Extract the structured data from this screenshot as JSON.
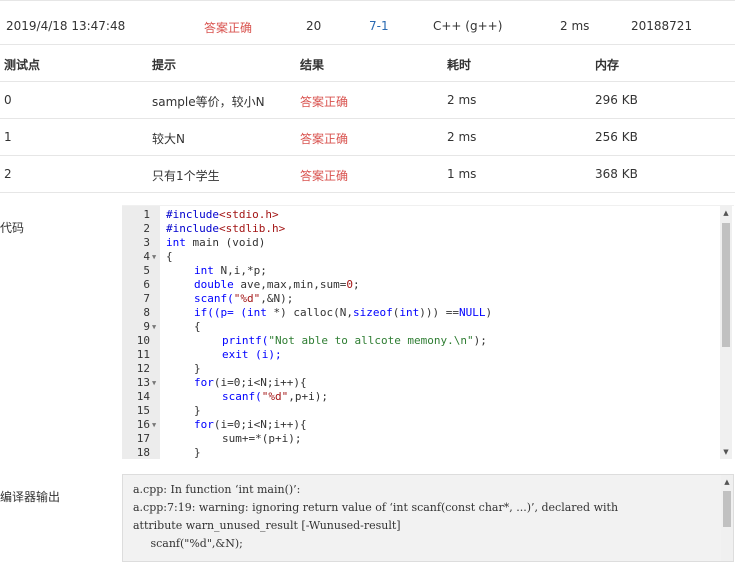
{
  "submission": {
    "time": "2019/4/18 13:47:48",
    "status": "答案正确",
    "score": "20",
    "problem": "7-1",
    "compiler": "C++ (g++)",
    "elapsed": "2 ms",
    "user": "20188721"
  },
  "results_table": {
    "headers": [
      "测试点",
      "提示",
      "结果",
      "耗时",
      "内存"
    ],
    "rows": [
      {
        "case": "0",
        "hint": "sample等价，较小N",
        "result": "答案正确",
        "time": "2 ms",
        "memory": "296 KB"
      },
      {
        "case": "1",
        "hint": "较大N",
        "result": "答案正确",
        "time": "2 ms",
        "memory": "256 KB"
      },
      {
        "case": "2",
        "hint": "只有1个学生",
        "result": "答案正确",
        "time": "1 ms",
        "memory": "368 KB"
      }
    ]
  },
  "code_section": {
    "label": "代码",
    "line_numbers": [
      "1",
      "2",
      "3",
      "4",
      "5",
      "6",
      "7",
      "8",
      "9",
      "10",
      "11",
      "12",
      "13",
      "14",
      "15",
      "16",
      "17",
      "18"
    ],
    "tokens": {
      "l1_a": "#include",
      "l1_b": "<stdio.h>",
      "l2_a": "#include",
      "l2_b": "<stdlib.h>",
      "l3_a": "int",
      "l3_b": " main (void)",
      "l4": "{",
      "l5_a": "int",
      "l5_b": " N,i,*p;",
      "l6_a": "double",
      "l6_b": " ave,max,min,sum=",
      "l6_c": "0",
      "l6_d": ";",
      "l7_a": "scanf(",
      "l7_b": "\"%d\"",
      "l7_c": ",&N);",
      "l8_a": "if((p= (",
      "l8_b": "int",
      "l8_c": " *) calloc(N,",
      "l8_d": "sizeof",
      "l8_e": "(",
      "l8_f": "int",
      "l8_g": "))) ==",
      "l8_h": "NULL",
      "l8_i": ")",
      "l9": "{",
      "l10_a": "printf(",
      "l10_b": "\"Not able to allcote memony.\\n\"",
      "l10_c": ");",
      "l11": "exit (i);",
      "l12": "}",
      "l13_a": "for",
      "l13_b": "(i=0;i<N;i++){",
      "l14_a": "scanf(",
      "l14_b": "\"%d\"",
      "l14_c": ",p+i);",
      "l15": "}",
      "l16_a": "for",
      "l16_b": "(i=0;i<N;i++){",
      "l17": "sum+=*(p+i);",
      "l18": "}"
    }
  },
  "compiler_section": {
    "label": "编译器输出",
    "lines": [
      "a.cpp: In function ‘int main()’:",
      "a.cpp:7:19: warning: ignoring return value of ‘int scanf(const char*, ...)’, declared with",
      "attribute warn_unused_result [-Wunused-result]",
      "     scanf(\"%d\",&N);"
    ]
  },
  "colors": {
    "accepted": "#d9534f",
    "problem_link": "#2a6ab2",
    "keyword": "#0000ff",
    "string": "#a31515"
  }
}
